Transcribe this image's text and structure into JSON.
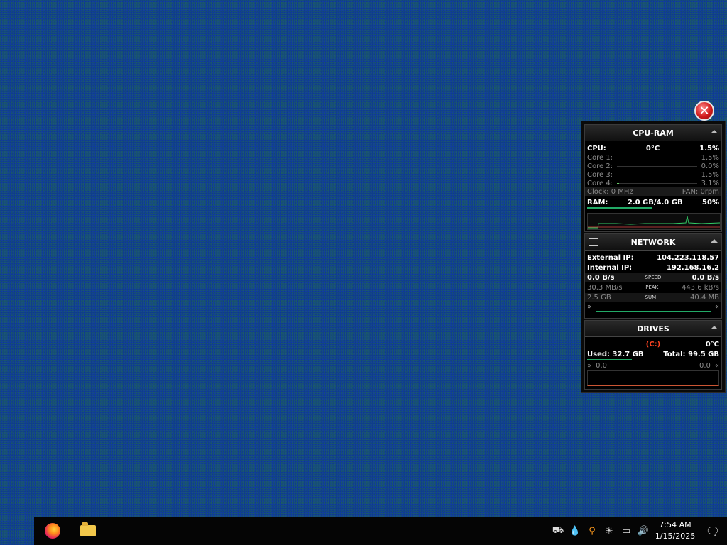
{
  "close_button": {
    "glyph": "✕"
  },
  "cpu_ram": {
    "title": "CPU-RAM",
    "cpu_label": "CPU:",
    "cpu_temp": "0°C",
    "cpu_usage": "1.5%",
    "cores": [
      {
        "label": "Core 1:",
        "value": "1.5%",
        "fraction": 0.015
      },
      {
        "label": "Core 2:",
        "value": "0.0%",
        "fraction": 0.0
      },
      {
        "label": "Core 3:",
        "value": "1.5%",
        "fraction": 0.015
      },
      {
        "label": "Core 4:",
        "value": "3.1%",
        "fraction": 0.031
      }
    ],
    "clock": "Clock: 0 MHz",
    "fan": "FAN: 0rpm",
    "ram_label": "RAM:",
    "ram_value": "2.0 GB/4.0 GB",
    "ram_percent": "50%"
  },
  "network": {
    "title": "NETWORK",
    "external_ip_label": "External IP:",
    "external_ip": "104.223.118.57",
    "internal_ip_label": "Internal IP:",
    "internal_ip": "192.168.16.2",
    "speed_down": "0.0 B/s",
    "speed_label": "SPEED",
    "speed_up": "0.0 B/s",
    "peak_down": "30.3 MB/s",
    "peak_label": "PEAK",
    "peak_up": "443.6 kB/s",
    "sum_down": "2.5 GB",
    "sum_label": "SUM",
    "sum_up": "40.4 MB"
  },
  "drives": {
    "title": "DRIVES",
    "drive_letter": "(C:)",
    "temp": "0°C",
    "used": "Used: 32.7 GB",
    "total": "Total: 99.5 GB",
    "read": "0.0",
    "write": "0.0"
  },
  "taskbar": {
    "clock_time": "7:54 AM",
    "clock_date": "1/15/2025",
    "tray_icons": [
      "network-people-icon",
      "droplet-icon",
      "search-magnifier-icon",
      "snowflake-icon",
      "network-icon",
      "volume-icon"
    ]
  },
  "colors": {
    "accent_green": "#22aa66",
    "drive_red": "#ff4422",
    "desktop_blue": "#0f3d8c"
  }
}
